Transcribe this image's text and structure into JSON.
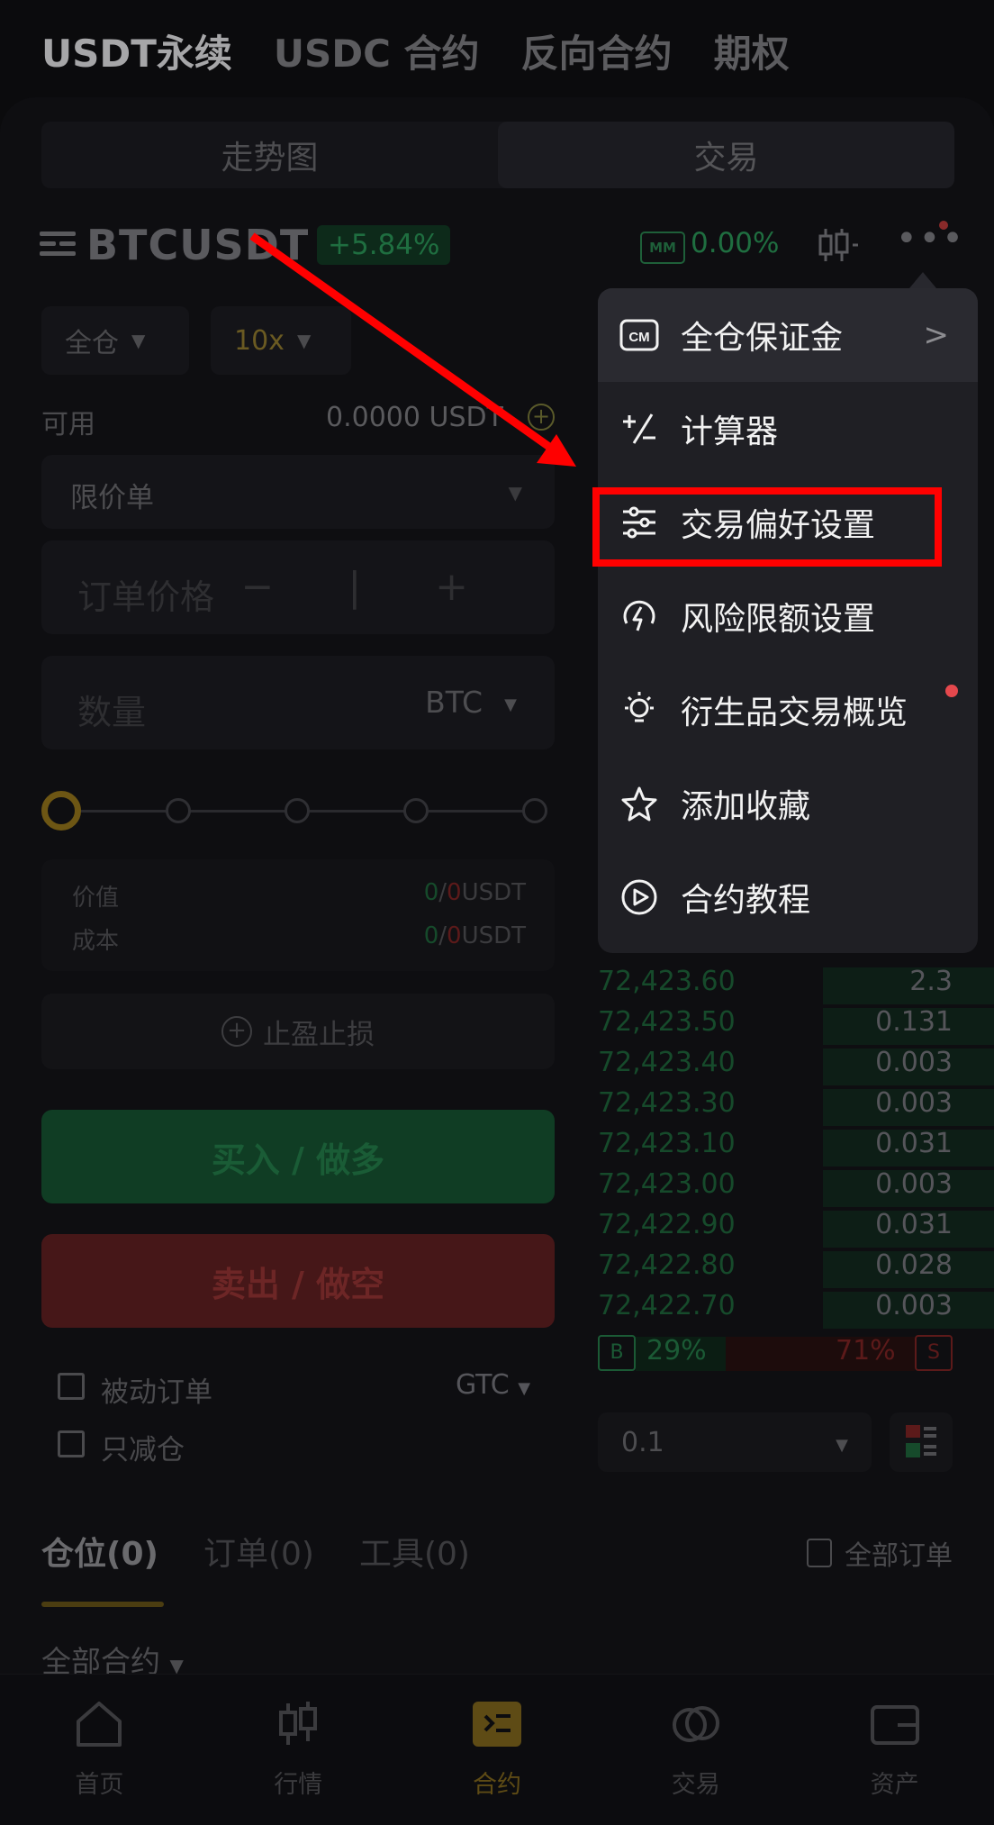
{
  "top_tabs": [
    "USDT永续",
    "USDC 合约",
    "反向合约",
    "期权"
  ],
  "segment": [
    "走势图",
    "交易"
  ],
  "symbol": "BTCUSDT",
  "change": "+5.84%",
  "mm_badge": "MM",
  "mm_value": "0.00%",
  "margin_mode": "全仓",
  "leverage": "10x",
  "available_label": "可用",
  "available_value": "0.0000 USDT",
  "order_type": "限价单",
  "price_placeholder": "订单价格",
  "price_controls": "− | +",
  "qty_placeholder": "数量",
  "qty_unit": "BTC",
  "value_label": "价值",
  "cost_label": "成本",
  "value_buy": "0",
  "value_sep": "/",
  "value_sell": "0",
  "value_unit": "USDT",
  "tpsl_label": "止盈止损",
  "buy_label": "买入 / 做多",
  "sell_label": "卖出 / 做空",
  "post_only_label": "被动订单",
  "reduce_only_label": "只减仓",
  "tif": "GTC",
  "order_book": [
    {
      "price": "72,423.60",
      "qty": "2.3"
    },
    {
      "price": "72,423.50",
      "qty": "0.131"
    },
    {
      "price": "72,423.40",
      "qty": "0.003"
    },
    {
      "price": "72,423.30",
      "qty": "0.003"
    },
    {
      "price": "72,423.10",
      "qty": "0.031"
    },
    {
      "price": "72,423.00",
      "qty": "0.003"
    },
    {
      "price": "72,422.90",
      "qty": "0.031"
    },
    {
      "price": "72,422.80",
      "qty": "0.028"
    },
    {
      "price": "72,422.70",
      "qty": "0.003"
    }
  ],
  "ratio": {
    "b_label": "B",
    "b_value": "29%",
    "s_value": "71%",
    "s_label": "S"
  },
  "depth_value": "0.1",
  "position_tabs": [
    "仓位(0)",
    "订单(0)",
    "工具(0)"
  ],
  "all_orders_label": "全部订单",
  "all_contracts_label": "全部合约",
  "bottom_nav": [
    "首页",
    "行情",
    "合约",
    "交易",
    "资产"
  ],
  "menu": {
    "cm_badge": "CM",
    "items": [
      "全仓保证金",
      "计算器",
      "交易偏好设置",
      "风险限额设置",
      "衍生品交易概览",
      "添加收藏",
      "合约教程"
    ],
    "chevron": ">"
  },
  "colors": {
    "accent": "#f0b90b",
    "buy": "#2ebd85",
    "sell": "#f6465d",
    "annotation": "#ff0000"
  }
}
